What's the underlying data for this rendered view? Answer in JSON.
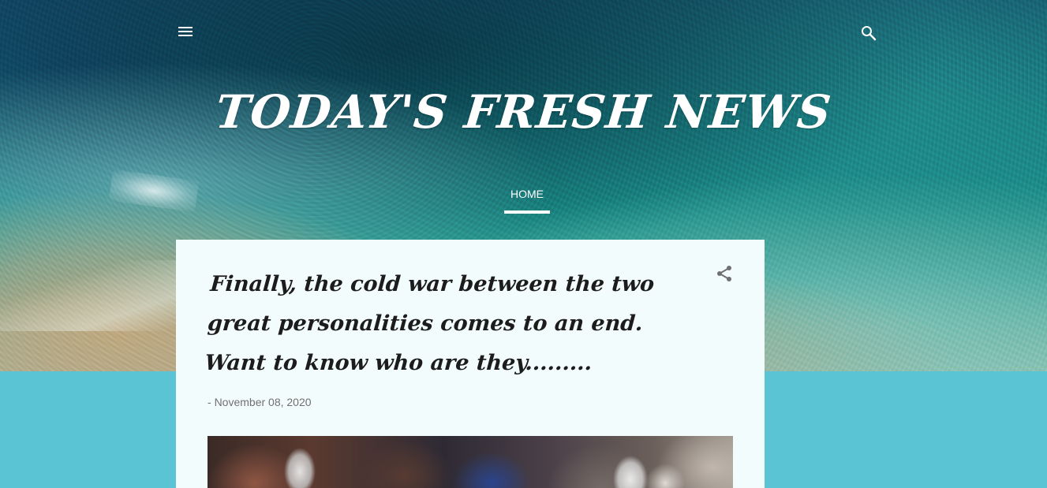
{
  "header": {
    "menu_icon": "hamburger-menu-icon",
    "search_icon": "search-icon",
    "site_title": "TODAY'S FRESH NEWS",
    "nav": [
      {
        "label": "HOME",
        "active": true
      }
    ]
  },
  "post": {
    "title": "Finally, the cold war between the two great personalities comes to an end. Want to know who are they.........",
    "date_prefix": "-",
    "date": "November 08, 2020",
    "share_icon": "share-icon"
  },
  "colors": {
    "page_background": "#5ac4d4",
    "card_background": "#f3fcfc",
    "title_text": "#ffffff",
    "post_title_text": "#1c1c1c",
    "date_text": "#707070"
  }
}
